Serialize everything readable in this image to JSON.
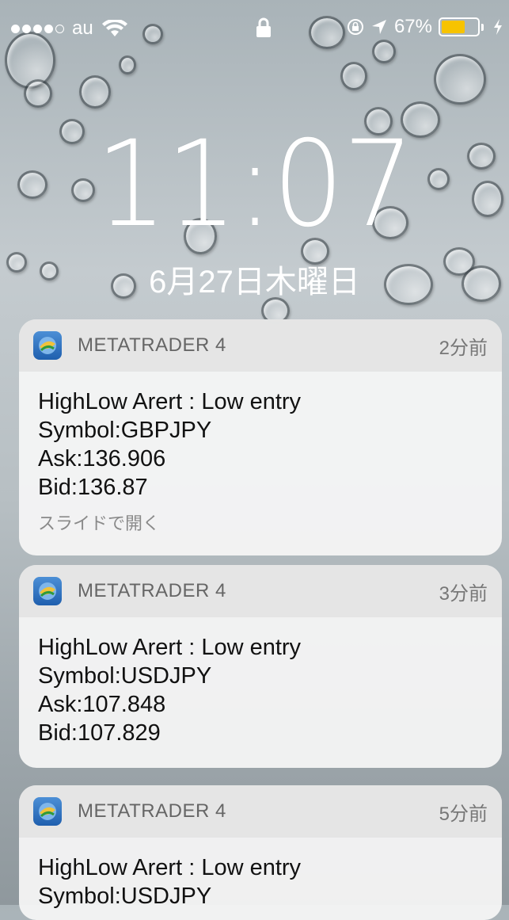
{
  "status_bar": {
    "carrier": "au",
    "battery_text": "67%",
    "battery_level": 0.67,
    "battery_color": "#f7c300",
    "icons": [
      "signal-dots",
      "wifi-icon",
      "lock-icon",
      "rotation-lock-icon",
      "location-icon",
      "battery-icon",
      "charging-bolt-icon"
    ]
  },
  "lock_screen": {
    "time": "11:07",
    "date": "6月27日木曜日"
  },
  "notifications": [
    {
      "app": "METATRADER 4",
      "time_ago": "2分前",
      "lines": [
        "HighLow Arert : Low entry",
        "Symbol:GBPJPY",
        "Ask:136.906",
        "Bid:136.87"
      ],
      "hint": "スライドで開く"
    },
    {
      "app": "METATRADER 4",
      "time_ago": "3分前",
      "lines": [
        "HighLow Arert : Low entry",
        "Symbol:USDJPY",
        "Ask:107.848",
        "Bid:107.829"
      ]
    },
    {
      "app": "METATRADER 4",
      "time_ago": "5分前",
      "lines": [
        "HighLow Arert : Low entry",
        "Symbol:USDJPY"
      ]
    }
  ]
}
